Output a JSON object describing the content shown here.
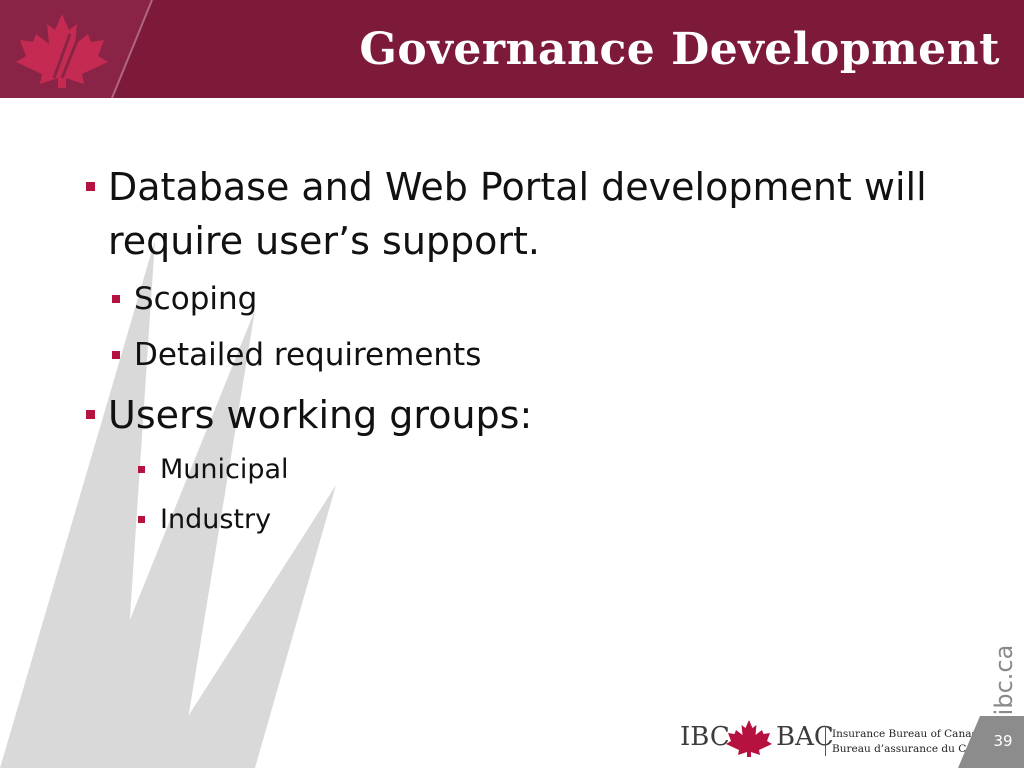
{
  "slide": {
    "title": "Governance Development",
    "bullets": [
      {
        "text": "Database and Web Portal development will require user’s support.",
        "children": [
          "Scoping",
          "Detailed requirements"
        ]
      },
      {
        "text": "Users working groups:",
        "children": [
          "Municipal",
          "Industry"
        ]
      }
    ],
    "page_number": "39"
  },
  "footer": {
    "url_vertical": "ibc.ca",
    "logo_left": "IBC",
    "logo_right": "BAC",
    "org_name_en": "Insurance Bureau of Canada",
    "org_name_fr": "Bureau d’assurance du Canada"
  },
  "colors": {
    "header_bg": "#7d1a3a",
    "bullet": "#b5123f",
    "decoration_gray": "#d9d9d9",
    "leaf_red": "#c42a52"
  }
}
